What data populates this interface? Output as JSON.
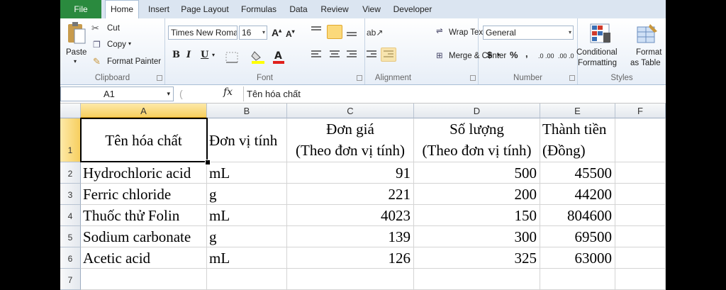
{
  "tabs": [
    "File",
    "Home",
    "Insert",
    "Page Layout",
    "Formulas",
    "Data",
    "Review",
    "View",
    "Developer"
  ],
  "clipboard": {
    "paste": "Paste",
    "cut": "Cut",
    "copy": "Copy",
    "format_painter": "Format Painter",
    "label": "Clipboard"
  },
  "font": {
    "name": "Times New Roma",
    "size": "16",
    "label": "Font",
    "bold": "B",
    "italic": "I",
    "underline": "U"
  },
  "alignment": {
    "wrap_text": "Wrap Text",
    "merge_center": "Merge & Center",
    "label": "Alignment"
  },
  "number": {
    "format": "General",
    "currency": "$",
    "percent": "%",
    "comma": ",",
    "inc_decimal": ".0→.00",
    "dec_decimal": ".00→.0",
    "label": "Number"
  },
  "styles": {
    "conditional": "Conditional",
    "formatting": "Formatting",
    "format": "Format",
    "as_table": "as Table",
    "label": "Styles"
  },
  "formula_bar": {
    "name_box": "A1",
    "fx": "fx",
    "content": "Tên hóa chất"
  },
  "grid": {
    "columns": [
      "A",
      "B",
      "C",
      "D",
      "E",
      "F"
    ],
    "rows": [
      "1",
      "2",
      "3",
      "4",
      "5",
      "6",
      "7"
    ],
    "header": {
      "a": "Tên hóa chất",
      "b": "Đơn vị tính",
      "c1": "Đơn giá",
      "c2": "(Theo đơn vị tính)",
      "d1": "Số lượng",
      "d2": "(Theo đơn vị tính)",
      "e1": "Thành tiền",
      "e2": "(Đồng)"
    },
    "data": [
      [
        "Hydrochloric acid",
        "mL",
        "91",
        "500",
        "45500"
      ],
      [
        "Ferric chloride",
        "g",
        "221",
        "200",
        "44200"
      ],
      [
        "Thuốc thử Folin",
        "mL",
        "4023",
        "150",
        "804600"
      ],
      [
        "Sodium carbonate",
        "g",
        "139",
        "300",
        "69500"
      ],
      [
        "Acetic acid",
        "mL",
        "126",
        "325",
        "63000"
      ]
    ]
  },
  "colors": {
    "file_tab": "#2a8a3e",
    "selection": "#fbd97b"
  }
}
